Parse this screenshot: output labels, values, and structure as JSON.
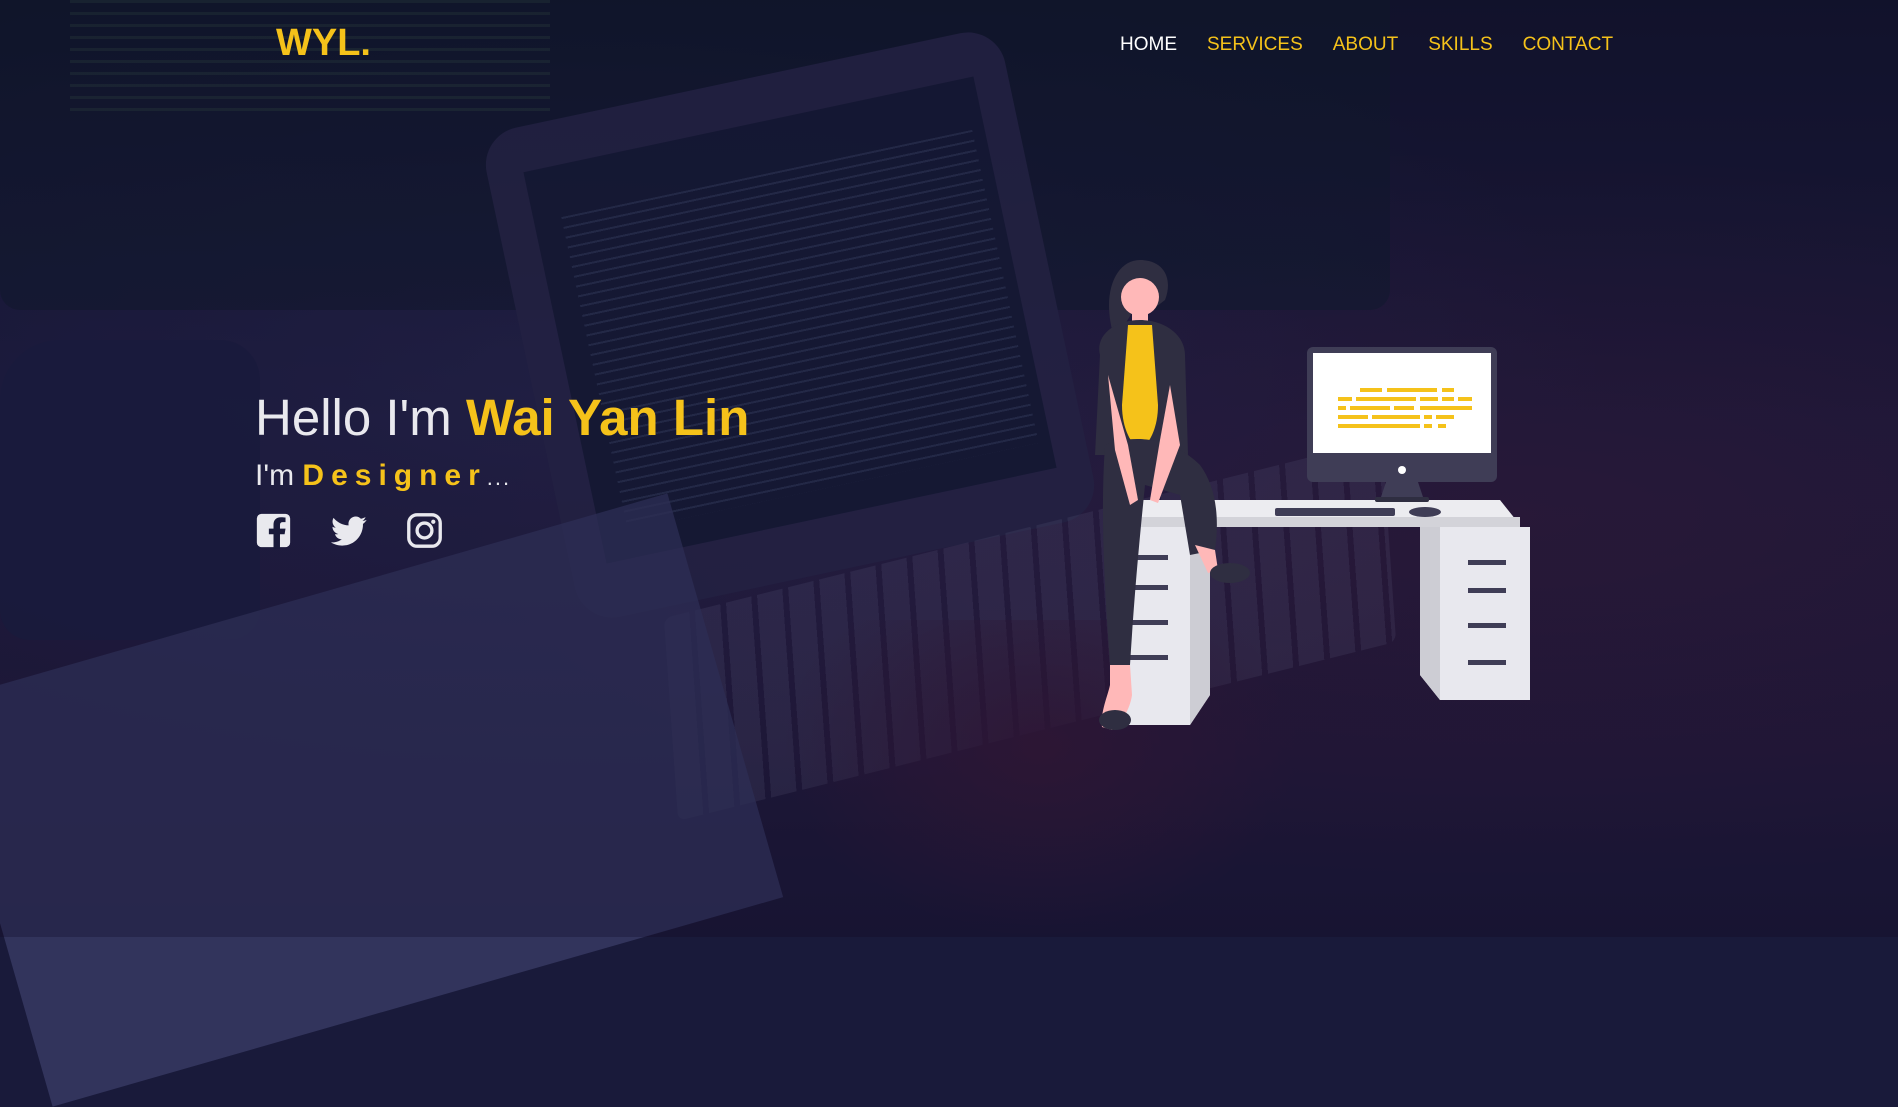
{
  "brand": {
    "logo": "WYL."
  },
  "nav": {
    "items": [
      {
        "label": "HOME",
        "active": true
      },
      {
        "label": "SERVICES",
        "active": false
      },
      {
        "label": "ABOUT",
        "active": false
      },
      {
        "label": "SKILLS",
        "active": false
      },
      {
        "label": "CONTACT",
        "active": false
      }
    ]
  },
  "hero": {
    "greeting": "Hello I'm",
    "name": "Wai Yan Lin",
    "role_prefix": "I'm",
    "role_word": "Designer",
    "role_suffix": "..."
  },
  "social": [
    {
      "icon": "facebook-icon"
    },
    {
      "icon": "twitter-icon"
    },
    {
      "icon": "instagram-icon"
    }
  ],
  "colors": {
    "accent": "#f5c21a",
    "text": "#e9e9ee",
    "background": "#191a3a"
  }
}
